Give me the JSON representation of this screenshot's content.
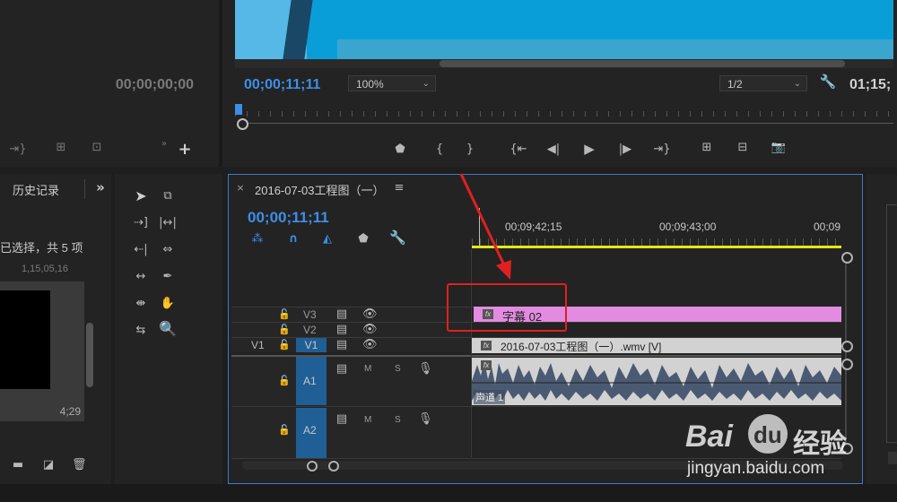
{
  "source_monitor": {
    "timecode": "00;00;00;00"
  },
  "program_monitor": {
    "timecode": "00;00;11;11",
    "zoom": "100%",
    "resolution": "1/2",
    "duration": "01;15;"
  },
  "history_panel": {
    "tab_label": "历史记录",
    "selection_text": "已选择，共 5 项",
    "thumb_time_top": "1,15,05,16",
    "thumb_duration": "4;29"
  },
  "sequence": {
    "tab_title": "2016-07-03工程图（一）",
    "timecode": "00;00;11;11",
    "ruler_labels": [
      "00;09;42;15",
      "00;09;43;00",
      "00;09"
    ]
  },
  "tracks": {
    "v3": {
      "label": "V3"
    },
    "v2": {
      "label": "V2"
    },
    "v1": {
      "label": "V1",
      "source_label": "V1"
    },
    "a1": {
      "label": "A1",
      "m": "M",
      "s": "S"
    },
    "a2": {
      "label": "A2",
      "m": "M",
      "s": "S"
    }
  },
  "clips": {
    "title_clip": {
      "fx": "fx",
      "name": "字幕 02",
      "color": "#e28be0"
    },
    "video_clip": {
      "fx": "fx",
      "name": "2016-07-03工程图（一）.wmv [V]",
      "color": "#d2d2d2"
    },
    "audio_clip": {
      "fx": "fx",
      "channel_label": "声道 1"
    }
  },
  "watermark": {
    "logo_text": "Bai",
    "logo_text2": "du",
    "logo_cn": "经验",
    "url": "jingyan.baidu.com"
  },
  "colors": {
    "accent": "#3d8ee8",
    "highlight_box": "#e02020",
    "playhead_bar": "#e6e619",
    "title_clip": "#e28be0"
  }
}
